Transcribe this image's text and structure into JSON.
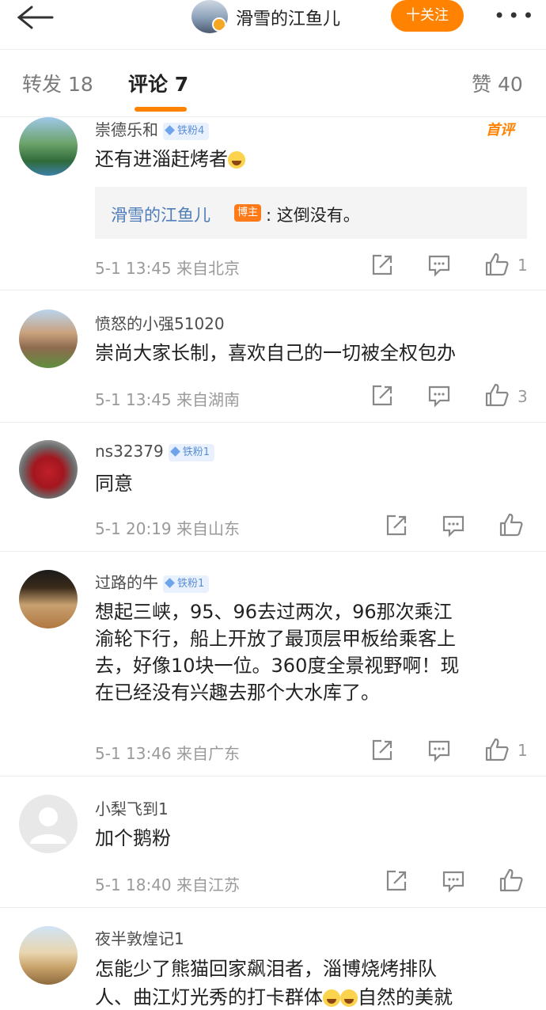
{
  "header": {
    "back_icon": "arrow-left-icon",
    "nickname": "滑雪的江鱼儿",
    "follow_label": "十关注",
    "more_icon": "more-dots-icon"
  },
  "tabs": [
    {
      "label": "转发 18"
    },
    {
      "label": "评论 7"
    },
    {
      "label": "赞 40"
    }
  ],
  "comments": [
    {
      "name": "崇德乐和",
      "fan_badge": "铁粉4",
      "first_badge": "首评",
      "text": "还有进淄赶烤者",
      "reply": {
        "name": "滑雪的江鱼儿",
        "badge": "博主",
        "text": ": 这倒没有。"
      },
      "time": "5-1 13:45",
      "location": "来自北京",
      "likes": "1"
    },
    {
      "name": "愤怒的小强51020",
      "text": "崇尚大家长制，喜欢自己的一切被全权包办",
      "time": "5-1 13:45",
      "location": "来自湖南",
      "likes": "3"
    },
    {
      "name": "ns32379",
      "fan_badge": "铁粉1",
      "text": "同意",
      "time": "5-1 20:19",
      "location": "来自山东",
      "likes": ""
    },
    {
      "name": "过路的牛",
      "fan_badge": "铁粉1",
      "text_lines": [
        "想起三峡，95、96去过两次，96那次乘江",
        "渝轮下行，船上开放了最顶层甲板给乘客上",
        "去，好像10块一位。360度全景视野啊！现",
        "在已经没有兴趣去那个大水库了。"
      ],
      "time": "5-1 13:46",
      "location": "来自广东",
      "likes": "1"
    },
    {
      "name": "小梨飞到1",
      "text": "加个鹅粉",
      "time": "5-1 18:40",
      "location": "来自江苏",
      "likes": ""
    },
    {
      "name": "夜半敦煌记1",
      "text_lines": [
        "怎能少了熊猫回家飙泪者，淄博烧烤排队",
        "人、曲江灯光秀的打卡群体",
        "自然的美就"
      ],
      "time": "",
      "location": "",
      "likes": ""
    }
  ],
  "colors": {
    "accent": "#ff8200",
    "link": "#4d7cb8",
    "meta": "#9a9a9a"
  }
}
